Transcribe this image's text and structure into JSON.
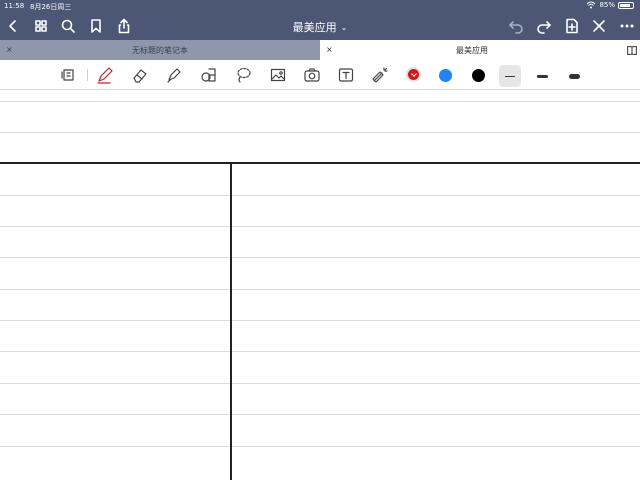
{
  "status_bar": {
    "time": "11:58",
    "date": "8月26日周三",
    "battery": "85%"
  },
  "nav": {
    "title": "最美应用",
    "title_chevron": "⌄"
  },
  "tabs": [
    {
      "label": "无标题的笔记本",
      "close": "×"
    },
    {
      "label": "最美应用",
      "close": "×"
    }
  ],
  "toolbar": {
    "colors": [
      "#d11a1a",
      "#1e86f0",
      "#000000"
    ]
  },
  "theme": {
    "bar_color": "#4b5775",
    "inactive_tab": "#8f97ad"
  }
}
